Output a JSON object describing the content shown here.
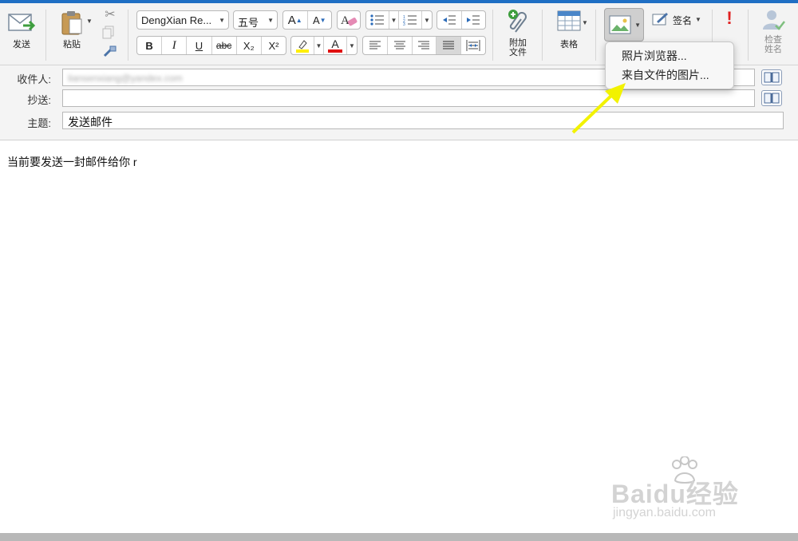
{
  "toolbar": {
    "send_label": "发送",
    "paste_label": "粘贴",
    "font_name": "DengXian Re...",
    "font_size": "五号",
    "bold": "B",
    "italic": "I",
    "underline": "U",
    "strike": "abc",
    "subscript": "X₂",
    "superscript": "X²",
    "grow_font": "A",
    "shrink_font": "A",
    "font_color_glyph": "A",
    "attach_label_1": "附加",
    "attach_label_2": "文件",
    "table_label": "表格",
    "signature_label": "签名",
    "check_names_1": "检查",
    "check_names_2": "姓名",
    "importance_glyph": "!"
  },
  "colors": {
    "highlight": "#ffef00",
    "font_color": "#e01010",
    "accent": "#1f6fc4",
    "arrow": "#f2f200"
  },
  "header": {
    "to_label": "收件人:",
    "cc_label": "抄送:",
    "subject_label": "主题:",
    "subject_value": "发送邮件",
    "to_value": "liansenxiang@yandex.com"
  },
  "body": {
    "text": "当前要发送一封邮件给你 r"
  },
  "picture_menu": {
    "items": [
      "照片浏览器...",
      "来自文件的图片..."
    ]
  },
  "watermark": {
    "brand": "Baidu经验",
    "url": "jingyan.baidu.com"
  }
}
